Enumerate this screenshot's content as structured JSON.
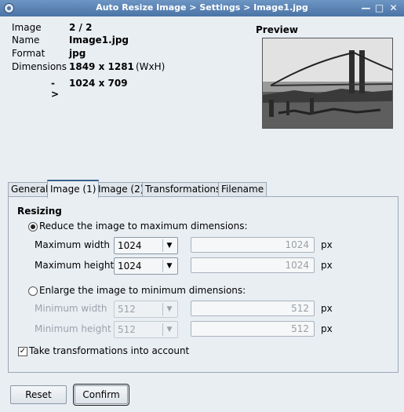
{
  "window": {
    "title": "Auto Resize Image > Settings > Image1.jpg"
  },
  "info": {
    "image_label": "Image",
    "image_value": "2 / 2",
    "name_label": "Name",
    "name_value": "Image1.jpg",
    "format_label": "Format",
    "format_value": "jpg",
    "dimensions_label": "Dimensions",
    "dimensions_value": "1849 x 1281",
    "dimensions_unit": "(WxH)",
    "arrow": "->",
    "new_dimensions": "1024 x 709"
  },
  "preview": {
    "label": "Preview"
  },
  "tabs": [
    {
      "label": "General"
    },
    {
      "label": "Image (1)"
    },
    {
      "label": "Image (2)"
    },
    {
      "label": "Transformations"
    },
    {
      "label": "Filename"
    }
  ],
  "resizing": {
    "title": "Resizing",
    "reduce_label": "Reduce the image to maximum dimensions:",
    "max_width_label": "Maximum width",
    "max_width_combo": "1024",
    "max_width_value": "1024",
    "max_height_label": "Maximum height",
    "max_height_combo": "1024",
    "max_height_value": "1024",
    "enlarge_label": "Enlarge the image to minimum dimensions:",
    "min_width_label": "Minimum width",
    "min_width_combo": "512",
    "min_width_value": "512",
    "min_height_label": "Minimum height",
    "min_height_combo": "512",
    "min_height_value": "512",
    "unit": "px",
    "transform_label": "Take transformations into account"
  },
  "buttons": {
    "reset": "Reset",
    "confirm": "Confirm"
  }
}
